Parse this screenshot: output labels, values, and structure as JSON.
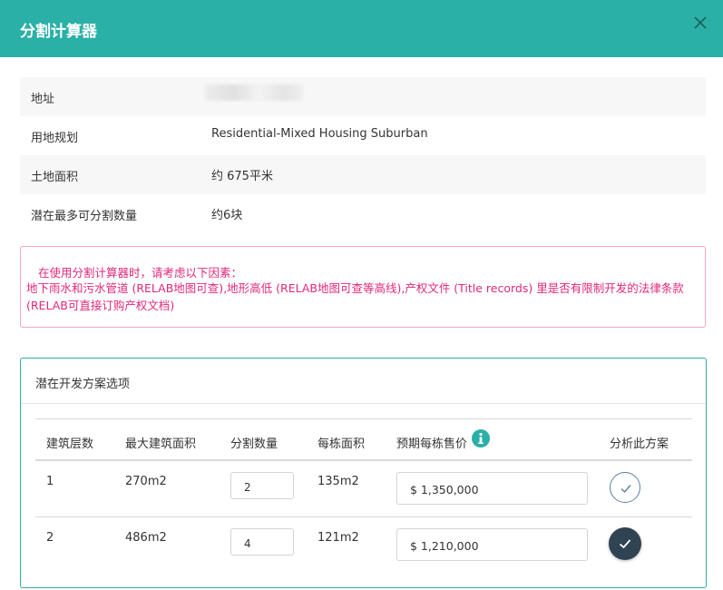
{
  "dialog": {
    "title": "分割计算器"
  },
  "info": {
    "address_label": "地址",
    "zoning_label": "用地规划",
    "zoning_value": "Residential-Mixed Housing Suburban",
    "land_area_label": "土地面积",
    "land_area_value": "约 675平米",
    "max_subdivision_label": "潜在最多可分割数量",
    "max_subdivision_value": "约6块"
  },
  "notice": {
    "line1": "在使用分割计算器时，请考虑以下因素：",
    "line2": "地下雨水和污水管道 (RELAB地图可查),地形高低 (RELAB地图可查等高线),产权文件 (Title records) 里是否有限制开发的法律条款(RELAB可直接订购产权文档)"
  },
  "options": {
    "title": "潜在开发方案选项",
    "headers": {
      "floors": "建筑层数",
      "max_area": "最大建筑面积",
      "subdivisions": "分割数量",
      "area_each": "每栋面积",
      "price_each": "预期每栋售价",
      "analyze": "分析此方案"
    },
    "rows": [
      {
        "floors": "1",
        "max_area": "270m2",
        "subdivisions": "2",
        "area_each": "135m2",
        "price": "$ 1,350,000",
        "selected": false
      },
      {
        "floors": "2",
        "max_area": "486m2",
        "subdivisions": "4",
        "area_each": "121m2",
        "price": "$ 1,210,000",
        "selected": true
      }
    ]
  },
  "colors": {
    "header": "#2bb0a7",
    "notice_text": "#e0287a",
    "notice_border": "#f4a6c3",
    "check_filled": "#2f4353"
  },
  "icons": {
    "close": "close-icon",
    "info": "info-icon",
    "check": "check-icon"
  }
}
